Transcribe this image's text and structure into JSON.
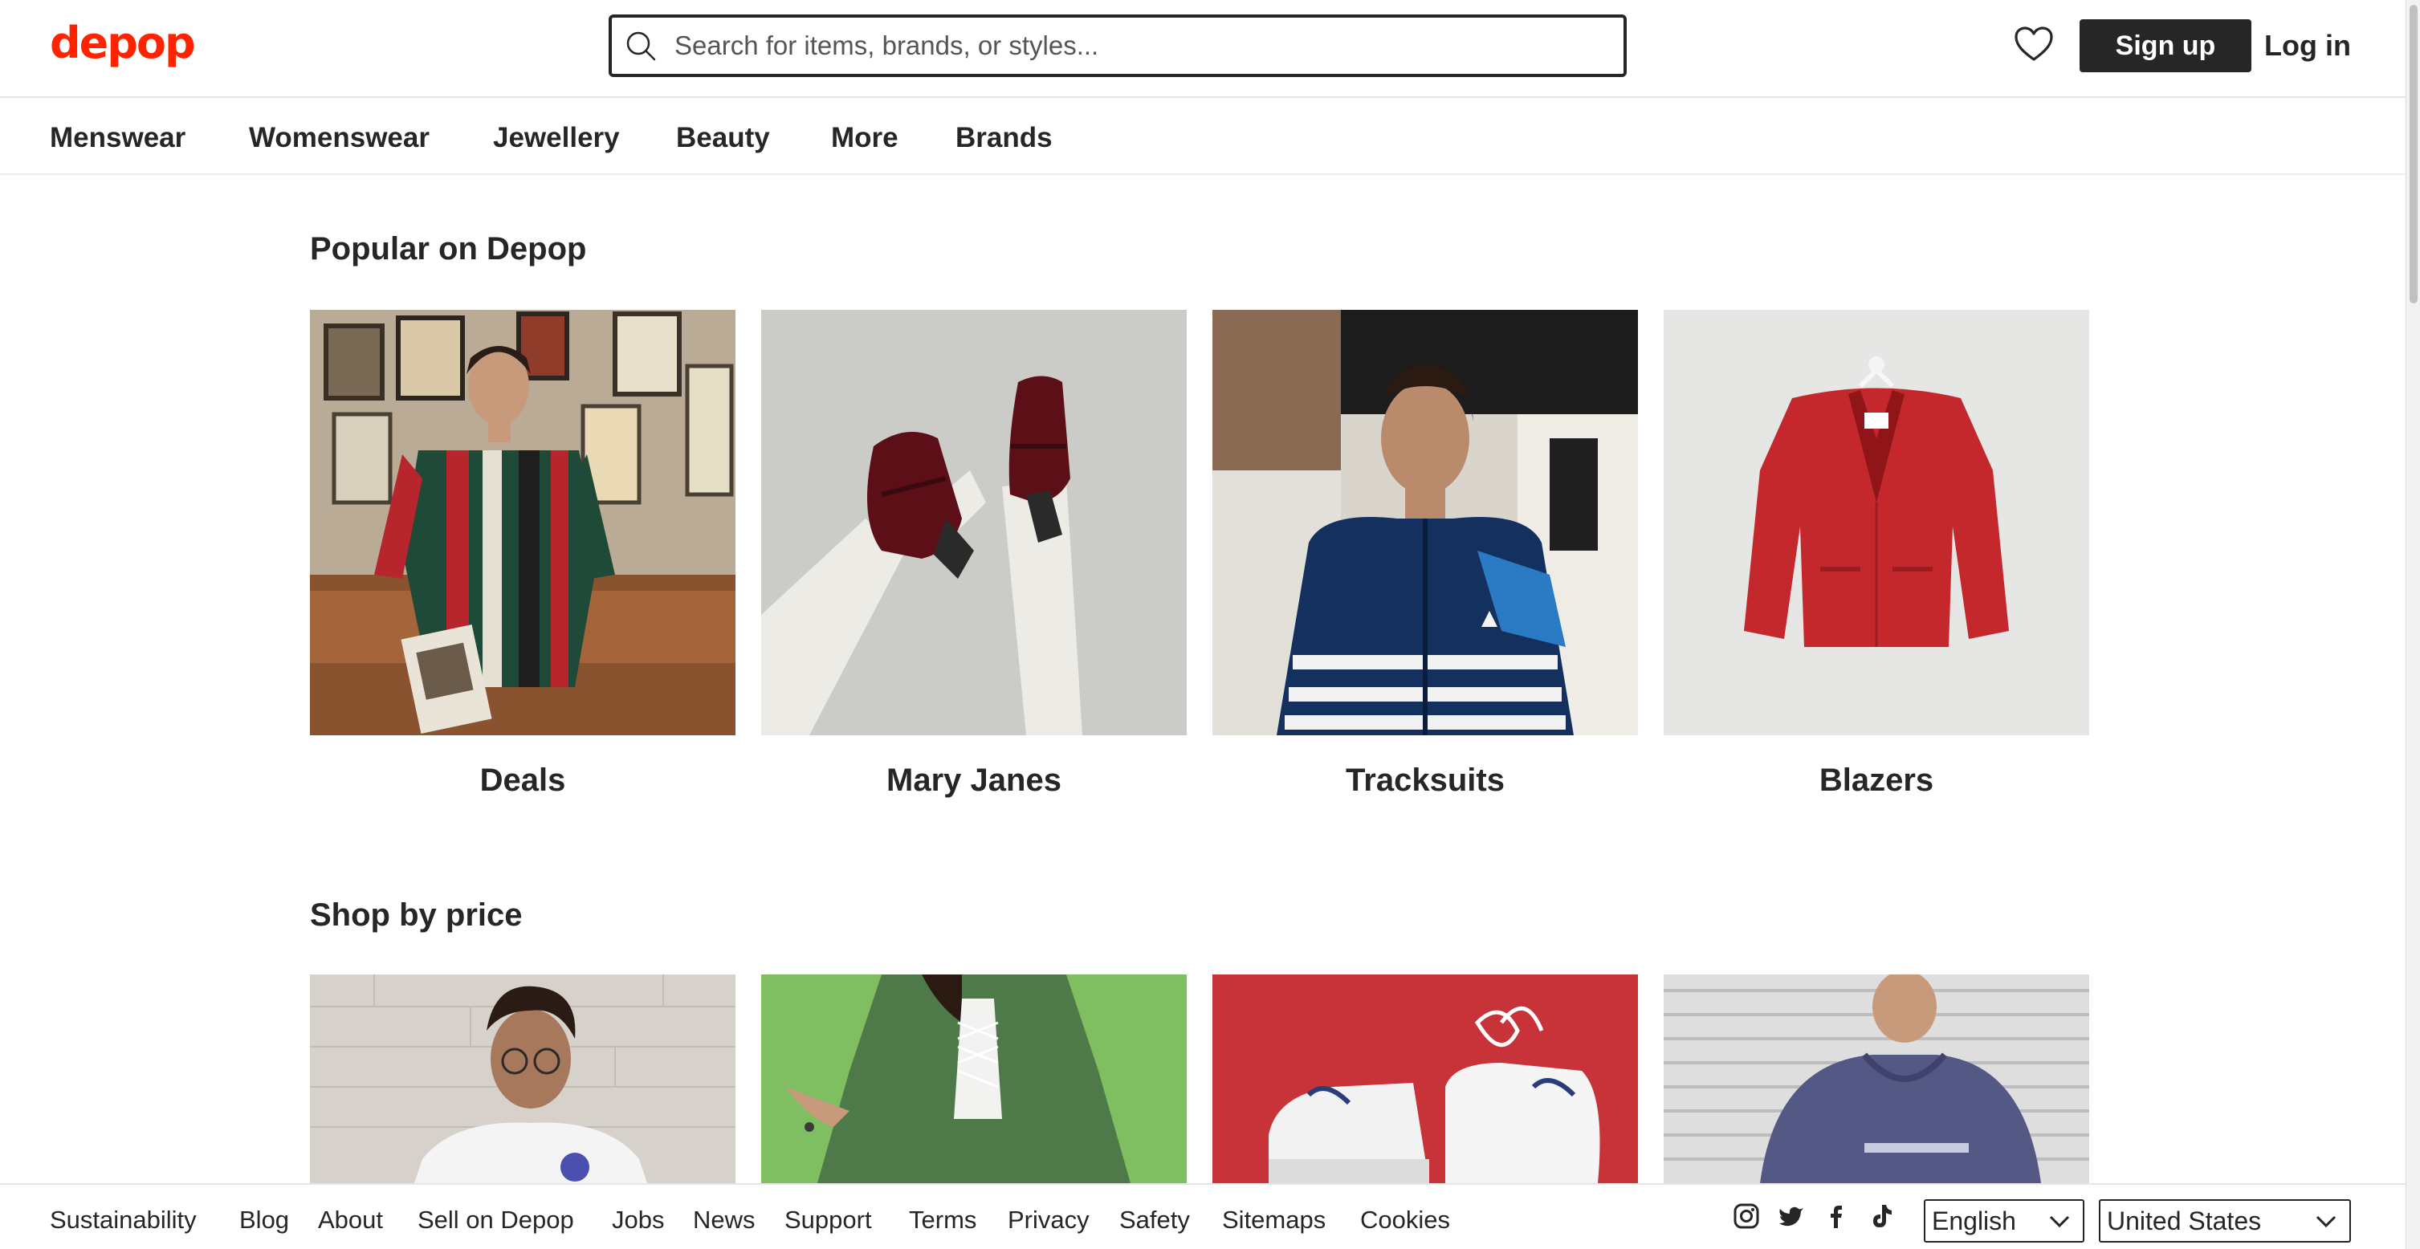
{
  "brand": {
    "logo": "depop",
    "color": "#ff2300"
  },
  "header": {
    "search_placeholder": "Search for items, brands, or styles...",
    "signup_label": "Sign up",
    "login_label": "Log in"
  },
  "nav": [
    "Menswear",
    "Womenswear",
    "Jewellery",
    "Beauty",
    "More",
    "Brands"
  ],
  "popular": {
    "title": "Popular on Depop",
    "tiles": [
      {
        "label": "Deals",
        "image": "man in striped polo shirt holding a magazine"
      },
      {
        "label": "Mary Janes",
        "image": "burgundy mary jane shoes with lace tights"
      },
      {
        "label": "Tracksuits",
        "image": "man in navy striped track jacket"
      },
      {
        "label": "Blazers",
        "image": "red blazer on hanger"
      }
    ]
  },
  "price": {
    "title": "Shop by price",
    "tiles": [
      {
        "image": "man in white graphic t-shirt"
      },
      {
        "image": "woman in green floral dress"
      },
      {
        "image": "white sneakers on red background"
      },
      {
        "image": "person in purple hoodie"
      }
    ]
  },
  "footer": {
    "links": [
      "Sustainability",
      "Blog",
      "About",
      "Sell on Depop",
      "Jobs",
      "News",
      "Support",
      "Terms",
      "Privacy",
      "Safety",
      "Sitemaps",
      "Cookies"
    ],
    "social": [
      "instagram-icon",
      "twitter-icon",
      "facebook-icon",
      "tiktok-icon"
    ],
    "language": "English",
    "country": "United States"
  }
}
